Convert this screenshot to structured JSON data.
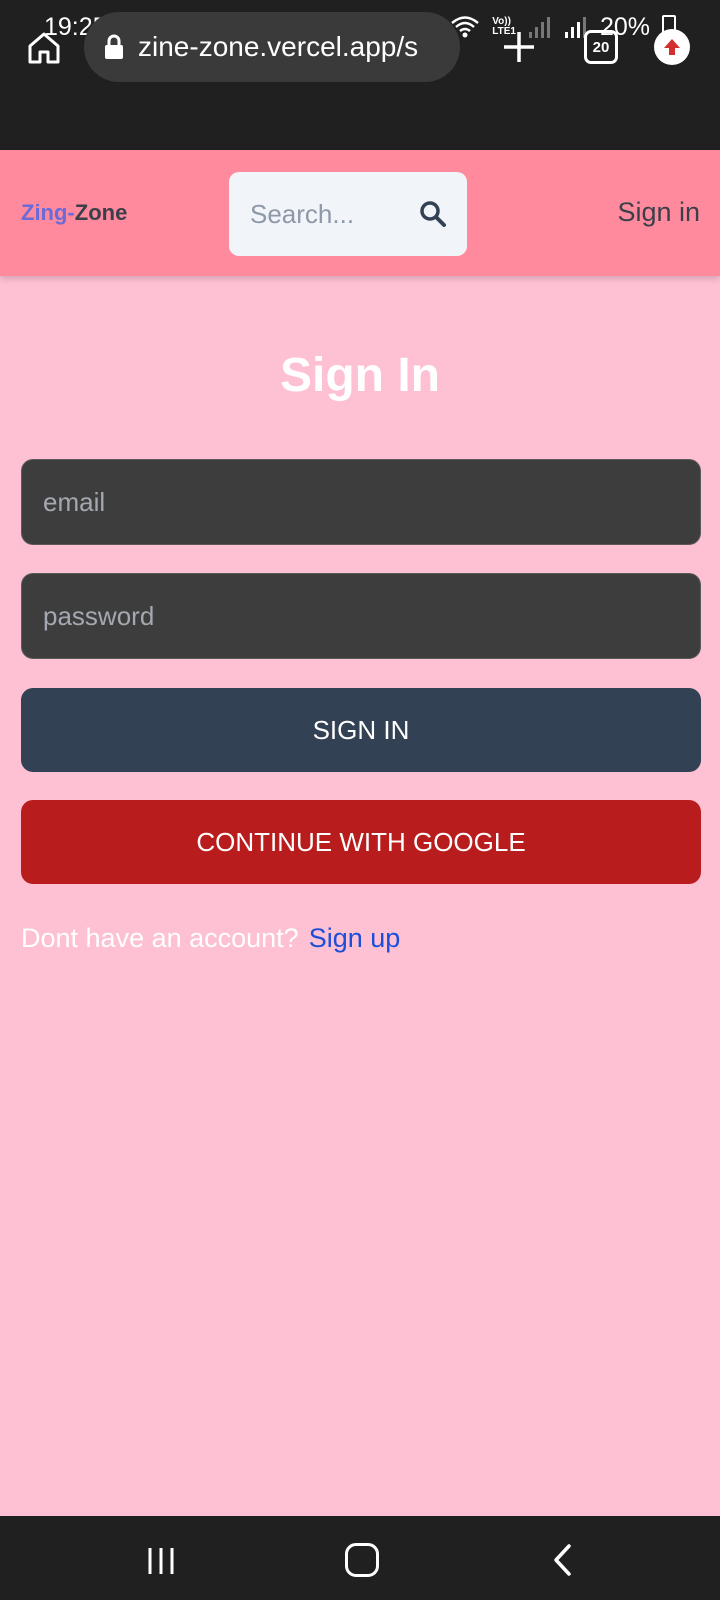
{
  "status_bar": {
    "time": "19:25",
    "battery": "20%",
    "network": "LTE1",
    "volte": "Vo))",
    "left_icons": [
      "gallery-icon",
      "instagram-icon",
      "instagram-icon",
      "dot-icon"
    ],
    "right_icons": [
      "battery-saver-icon",
      "mute-icon",
      "wifi-icon",
      "signal-icon",
      "signal-icon",
      "battery-icon"
    ]
  },
  "browser": {
    "url": "zine-zone.vercel.app/s",
    "tab_count": "20"
  },
  "header": {
    "logo_part1": "Zing-",
    "logo_part2": "Zone",
    "search_placeholder": "Search...",
    "signin_link": "Sign in"
  },
  "form": {
    "title": "Sign In",
    "email_placeholder": "email",
    "password_placeholder": "password",
    "signin_button": "SIGN IN",
    "google_button": "CONTINUE WITH GOOGLE",
    "account_prompt": "Dont have an account?",
    "signup_link": "Sign up"
  },
  "colors": {
    "page_bg": "#fec0d3",
    "header_bg": "#ff8a9e",
    "signin_btn": "#334155",
    "google_btn": "#b91c1c",
    "link": "#1d4ed8",
    "logo_accent": "#6b6bd8"
  }
}
